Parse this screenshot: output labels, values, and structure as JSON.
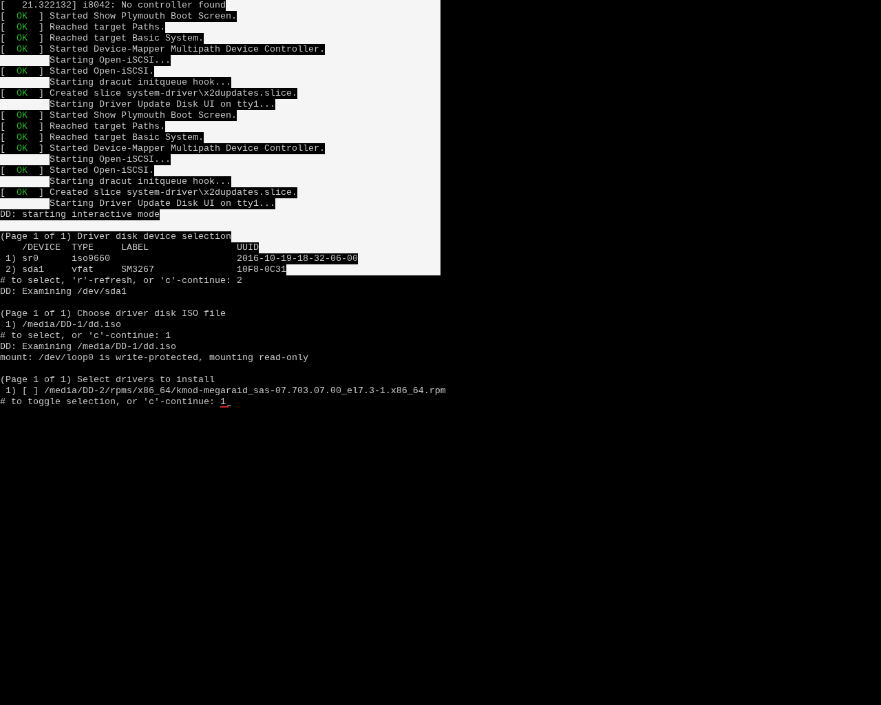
{
  "boot_log": [
    {
      "kind": "plain",
      "text": "[   21.322132] i8042: No controller found"
    },
    {
      "kind": "status",
      "open": "[",
      "status": "OK",
      "close": "]",
      "text": "Started Show Plymouth Boot Screen."
    },
    {
      "kind": "status",
      "open": "[",
      "status": "OK",
      "close": "]",
      "text": "Reached target Paths."
    },
    {
      "kind": "status",
      "open": "[",
      "status": "OK",
      "close": "]",
      "text": "Reached target Basic System."
    },
    {
      "kind": "status",
      "open": "[",
      "status": "OK",
      "close": "]",
      "text": "Started Device-Mapper Multipath Device Controller."
    },
    {
      "kind": "indent",
      "text": "Starting Open-iSCSI..."
    },
    {
      "kind": "status",
      "open": "[",
      "status": "OK",
      "close": "]",
      "text": "Started Open-iSCSI."
    },
    {
      "kind": "indent",
      "text": "Starting dracut initqueue hook..."
    },
    {
      "kind": "status",
      "open": "[",
      "status": "OK",
      "close": "]",
      "text": "Created slice system-driver\\x2dupdates.slice."
    },
    {
      "kind": "indent",
      "text": "Starting Driver Update Disk UI on tty1..."
    },
    {
      "kind": "status",
      "open": "[",
      "status": "OK",
      "close": "]",
      "text": "Started Show Plymouth Boot Screen."
    },
    {
      "kind": "status",
      "open": "[",
      "status": "OK",
      "close": "]",
      "text": "Reached target Paths."
    },
    {
      "kind": "status",
      "open": "[",
      "status": "OK",
      "close": "]",
      "text": "Reached target Basic System."
    },
    {
      "kind": "status",
      "open": "[",
      "status": "OK",
      "close": "]",
      "text": "Started Device-Mapper Multipath Device Controller."
    },
    {
      "kind": "indent",
      "text": "Starting Open-iSCSI..."
    },
    {
      "kind": "status",
      "open": "[",
      "status": "OK",
      "close": "]",
      "text": "Started Open-iSCSI."
    },
    {
      "kind": "indent",
      "text": "Starting dracut initqueue hook..."
    },
    {
      "kind": "status",
      "open": "[",
      "status": "OK",
      "close": "]",
      "text": "Created slice system-driver\\x2dupdates.slice."
    },
    {
      "kind": "indent",
      "text": "Starting Driver Update Disk UI on tty1..."
    },
    {
      "kind": "plain",
      "text": "DD: starting interactive mode"
    },
    {
      "kind": "blank"
    }
  ],
  "device_table": {
    "title": "(Page 1 of 1) Driver disk device selection",
    "columns": [
      "/DEVICE",
      "TYPE",
      "LABEL",
      "UUID"
    ],
    "rows": [
      {
        "number": "1)",
        "device": "sr0",
        "type": "iso9660",
        "uuid": "2016-10-19-18-32-06-00"
      },
      {
        "number": "2)",
        "device": "sda1",
        "type": "vfat",
        "label": "SM3267",
        "uuid": "10F8-0C31"
      }
    ]
  },
  "console": [
    {
      "kind": "plain",
      "text": "# to select, 'r'-refresh, or 'c'-continue: 2"
    },
    {
      "kind": "plain",
      "text": "DD: Examining /dev/sda1"
    },
    {
      "kind": "blank"
    },
    {
      "kind": "plain",
      "text": "(Page 1 of 1) Choose driver disk ISO file"
    },
    {
      "kind": "plain",
      "text": " 1) /media/DD-1/dd.iso"
    },
    {
      "kind": "plain",
      "text": "# to select, or 'c'-continue: 1"
    },
    {
      "kind": "plain",
      "text": "DD: Examining /media/DD-1/dd.iso"
    },
    {
      "kind": "plain",
      "text": "mount: /dev/loop0 is write-protected, mounting read-only"
    },
    {
      "kind": "blank"
    },
    {
      "kind": "plain",
      "text": "(Page 1 of 1) Select drivers to install"
    },
    {
      "kind": "plain",
      "text": " 1) [ ] /media/DD-2/rpms/x86_64/kmod-megaraid_sas-07.703.07.00_el7.3-1.x86_64.rpm"
    }
  ],
  "prompt": {
    "text": "# to toggle selection, or 'c'-continue: ",
    "value": "1"
  }
}
